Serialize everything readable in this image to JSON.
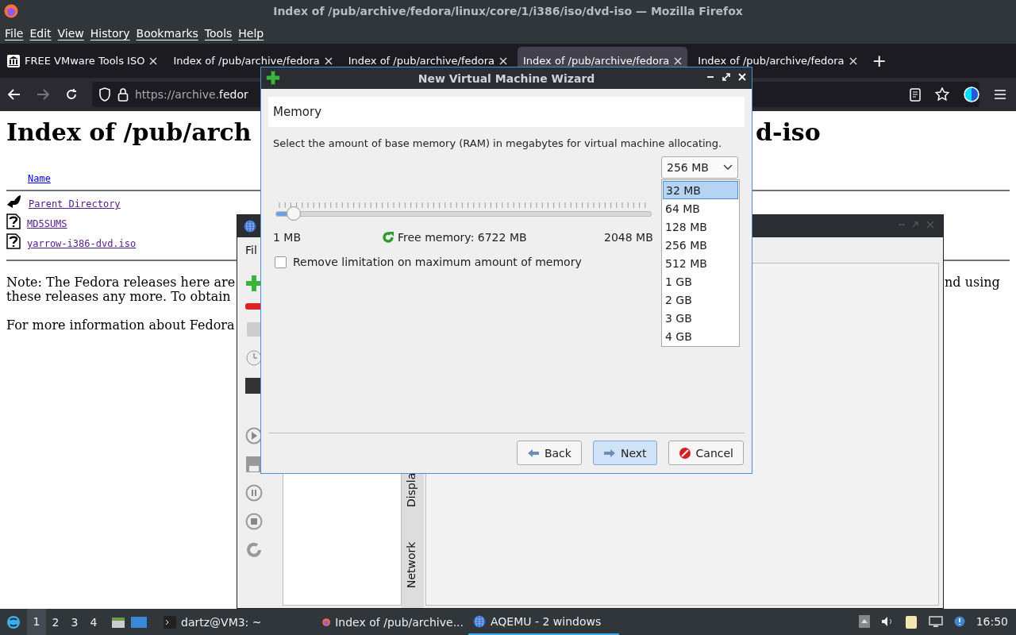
{
  "browser": {
    "title": "Index of /pub/archive/fedora/linux/core/1/i386/iso/dvd-iso — Mozilla Firefox",
    "menu": [
      "File",
      "Edit",
      "View",
      "History",
      "Bookmarks",
      "Tools",
      "Help"
    ],
    "tabs": [
      {
        "label": "FREE VMware Tools ISO",
        "selected": false
      },
      {
        "label": "Index of /pub/archive/fedora",
        "selected": false
      },
      {
        "label": "Index of /pub/archive/fedora",
        "selected": false
      },
      {
        "label": "Index of /pub/archive/fedora",
        "selected": true
      },
      {
        "label": "Index of /pub/archive/fedora",
        "selected": false
      }
    ],
    "new_tab": "+",
    "url_scheme": "https://archive.",
    "url_host": "fedor",
    "page": {
      "heading_left": "Index of /pub/arch",
      "heading_right": "d-iso",
      "column_header": "Name",
      "entries": [
        {
          "kind": "parent",
          "name": "Parent Directory"
        },
        {
          "kind": "file",
          "name": "MD5SUMS"
        },
        {
          "kind": "file",
          "name": "yarrow-i386-dvd.iso"
        }
      ],
      "note_left": "Note: The Fedora releases here are",
      "note_right": "nd using",
      "note_line2": "these releases any more. To obtain",
      "info": "For more information about Fedora"
    }
  },
  "aqemu": {
    "menu_fragment": "Fil",
    "side_tabs": [
      "Displa",
      "Network"
    ]
  },
  "wizard": {
    "title": "New Virtual Machine Wizard",
    "section": "Memory",
    "description": "Select the amount of base memory (RAM) in megabytes for virtual machine allocating.",
    "memory_select": "256 MB",
    "options": [
      {
        "label": "32 MB",
        "selected": true
      },
      {
        "label": "64 MB",
        "selected": false
      },
      {
        "label": "128 MB",
        "selected": false
      },
      {
        "label": "256 MB",
        "selected": false
      },
      {
        "label": "512 MB",
        "selected": false
      },
      {
        "label": "1 GB",
        "selected": false
      },
      {
        "label": "2 GB",
        "selected": false
      },
      {
        "label": "3 GB",
        "selected": false
      },
      {
        "label": "4 GB",
        "selected": false
      }
    ],
    "slider": {
      "level": 0.03,
      "min": "1 MB",
      "max": "2048 MB"
    },
    "free_memory": "Free memory: 6722 MB",
    "remove_limit": {
      "label": "Remove limitation on maximum amount of memory",
      "checked": false
    },
    "buttons": [
      {
        "kind": "back",
        "label": "Back",
        "selected": false
      },
      {
        "kind": "next",
        "label": "Next",
        "selected": true
      },
      {
        "kind": "cancel",
        "label": "Cancel",
        "selected": false
      }
    ]
  },
  "taskbar": {
    "workspaces": [
      {
        "label": "1",
        "selected": true
      },
      {
        "label": "2",
        "selected": false
      },
      {
        "label": "3",
        "selected": false
      },
      {
        "label": "4",
        "selected": false
      }
    ],
    "tasks": [
      {
        "kind": "terminal",
        "label": "dartz@VM3: ~",
        "selected": false
      },
      {
        "kind": "firefox",
        "label": "Index of /pub/archive...",
        "selected": false
      },
      {
        "kind": "aqemu",
        "label": "AQEMU - 2 windows",
        "selected": true
      }
    ],
    "clock": "16:50"
  }
}
